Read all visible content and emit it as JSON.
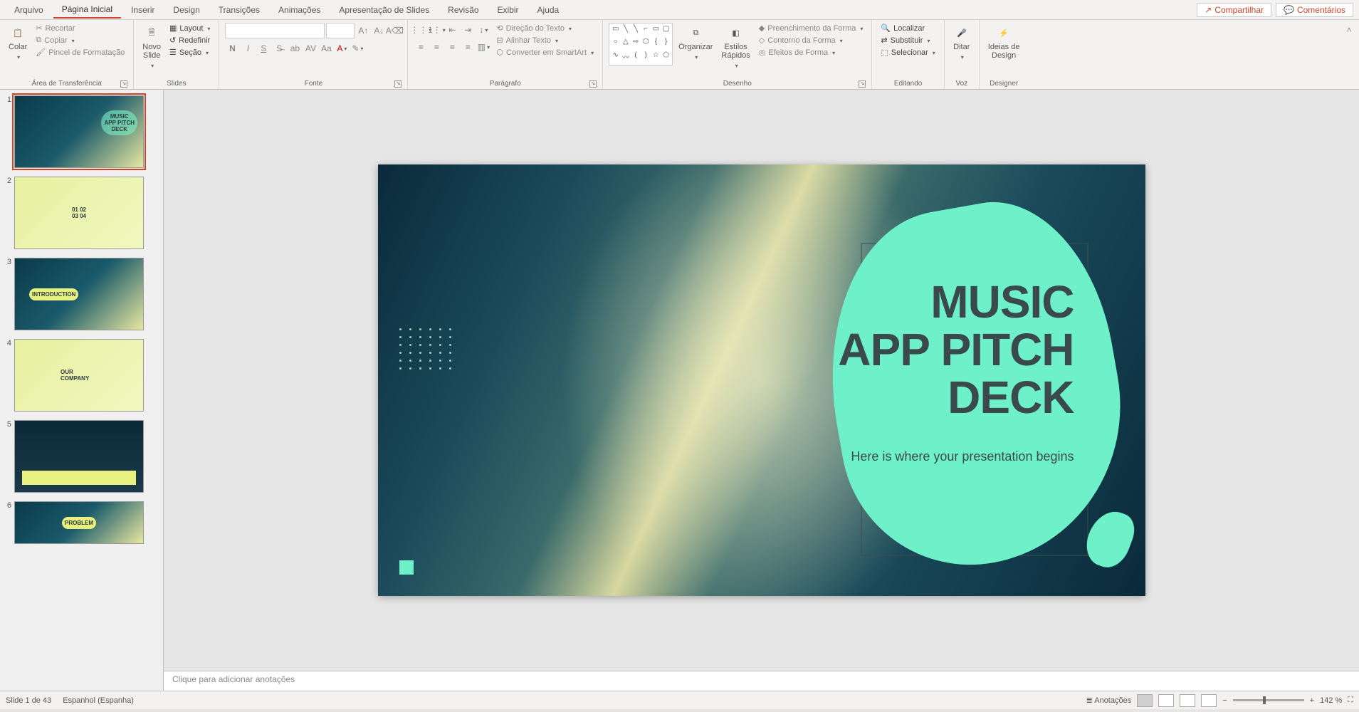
{
  "menu": {
    "tabs": [
      "Arquivo",
      "Página Inicial",
      "Inserir",
      "Design",
      "Transições",
      "Animações",
      "Apresentação de Slides",
      "Revisão",
      "Exibir",
      "Ajuda"
    ],
    "active": 1,
    "share": "Compartilhar",
    "comments": "Comentários"
  },
  "ribbon": {
    "clipboard": {
      "paste": "Colar",
      "cut": "Recortar",
      "copy": "Copiar",
      "formatPainter": "Pincel de Formatação",
      "label": "Área de Transferência"
    },
    "slides": {
      "newSlide": "Novo\nSlide",
      "layout": "Layout",
      "reset": "Redefinir",
      "section": "Seção",
      "label": "Slides"
    },
    "font": {
      "label": "Fonte"
    },
    "paragraph": {
      "label": "Parágrafo",
      "direction": "Direção do Texto",
      "align": "Alinhar Texto",
      "smartart": "Converter em SmartArt"
    },
    "drawing": {
      "arrange": "Organizar",
      "quickStyles": "Estilos\nRápidos",
      "shapeFill": "Preenchimento da Forma",
      "shapeOutline": "Contorno da Forma",
      "shapeEffects": "Efeitos de Forma",
      "label": "Desenho"
    },
    "editing": {
      "find": "Localizar",
      "replace": "Substituir",
      "select": "Selecionar",
      "label": "Editando"
    },
    "voice": {
      "dictate": "Ditar",
      "label": "Voz"
    },
    "designer": {
      "ideas": "Ideias de\nDesign",
      "label": "Designer"
    }
  },
  "slide": {
    "title_l1": "MUSIC",
    "title_l2": "APP PITCH",
    "title_l3": "DECK",
    "subtitle": "Here is where your presentation begins"
  },
  "thumbs": {
    "t1": "MUSIC\nAPP PITCH\nDECK",
    "t2": "01 02\n03 04",
    "t3": "INTRODUCTION",
    "t4": "OUR\nCOMPANY",
    "t5": "",
    "t6": "PROBLEM"
  },
  "notes": {
    "placeholder": "Clique para adicionar anotações"
  },
  "status": {
    "slideCount": "Slide 1 de 43",
    "language": "Espanhol (Espanha)",
    "notesBtn": "Anotações",
    "zoom": "142 %"
  }
}
